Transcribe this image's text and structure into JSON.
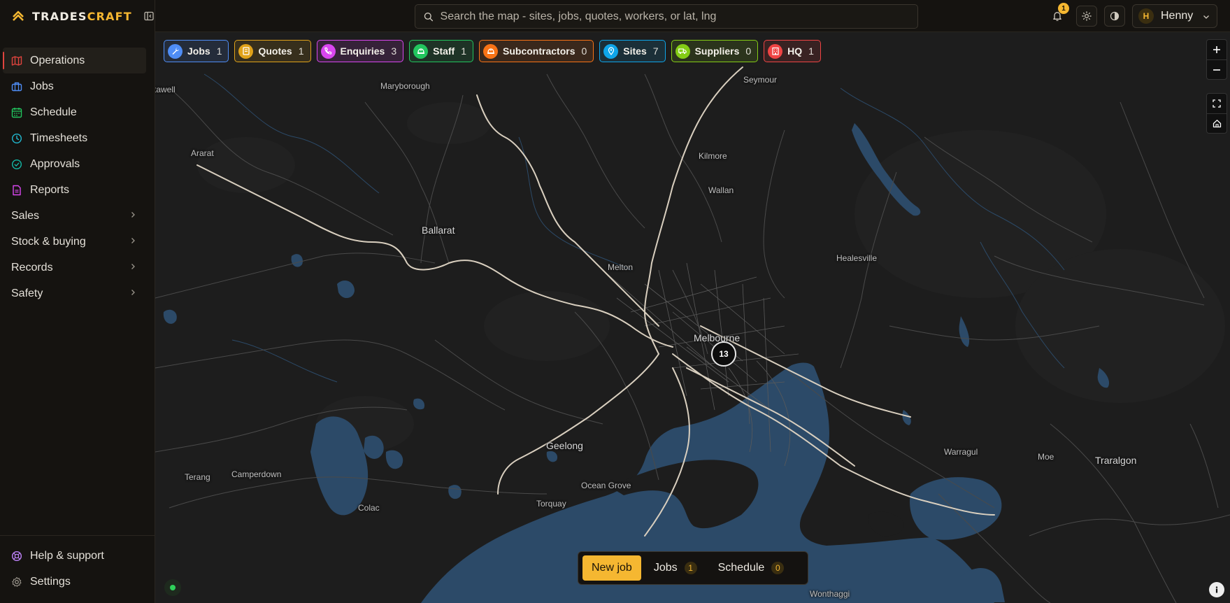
{
  "brand": {
    "name_part1": "TRADES",
    "name_part2": "CRAFT"
  },
  "sidebar": {
    "items": [
      {
        "label": "Operations",
        "icon": "map-icon",
        "color": "#e0443e"
      },
      {
        "label": "Jobs",
        "icon": "briefcase-icon",
        "color": "#4f8df5"
      },
      {
        "label": "Schedule",
        "icon": "calendar-icon",
        "color": "#22c55e"
      },
      {
        "label": "Timesheets",
        "icon": "clock-icon",
        "color": "#22b8cf"
      },
      {
        "label": "Approvals",
        "icon": "check-circle-icon",
        "color": "#14b8a6"
      },
      {
        "label": "Reports",
        "icon": "report-icon",
        "color": "#d946ef"
      }
    ],
    "groups": [
      {
        "label": "Sales"
      },
      {
        "label": "Stock & buying"
      },
      {
        "label": "Records"
      },
      {
        "label": "Safety"
      }
    ],
    "bottom": [
      {
        "label": "Help & support",
        "icon": "help-icon",
        "color": "#c084fc"
      },
      {
        "label": "Settings",
        "icon": "gear-icon",
        "color": "#9a958c"
      }
    ]
  },
  "topbar": {
    "search_placeholder": "Search the map - sites, jobs, quotes, workers, or lat, lng",
    "notification_count": "1",
    "user_initial": "H",
    "user_name": "Henny"
  },
  "map": {
    "layers": [
      {
        "label": "Jobs",
        "count": "1",
        "icon": "wrench-icon",
        "color": "#4f8df5"
      },
      {
        "label": "Quotes",
        "count": "1",
        "icon": "quote-icon",
        "color": "#e0a21a"
      },
      {
        "label": "Enquiries",
        "count": "3",
        "icon": "phone-icon",
        "color": "#d946ef"
      },
      {
        "label": "Staff",
        "count": "1",
        "icon": "hardhat-icon",
        "color": "#22c55e"
      },
      {
        "label": "Subcontractors",
        "count": "0",
        "icon": "hardhat-icon",
        "color": "#f97316"
      },
      {
        "label": "Sites",
        "count": "7",
        "icon": "pin-icon",
        "color": "#0ea5e9"
      },
      {
        "label": "Suppliers",
        "count": "0",
        "icon": "truck-icon",
        "color": "#84cc16"
      },
      {
        "label": "HQ",
        "count": "1",
        "icon": "building-icon",
        "color": "#ef4444"
      }
    ],
    "places": {
      "stawell": "tawell",
      "maryborough": "Maryborough",
      "seymour": "Seymour",
      "ararat": "Ararat",
      "kilmore": "Kilmore",
      "wallan": "Wallan",
      "ballarat": "Ballarat",
      "healesville": "Healesville",
      "melton": "Melton",
      "melbourne": "Melbourne",
      "geelong": "Geelong",
      "warragul": "Warragul",
      "moe": "Moe",
      "traralgon": "Traralgon",
      "terang": "Terang",
      "camperdown": "Camperdown",
      "ocean_grove": "Ocean Grove",
      "torquay": "Torquay",
      "colac": "Colac",
      "wonthaggi": "Wonthaggi"
    },
    "cluster_count": "13"
  },
  "action_bar": {
    "new_job": "New job",
    "jobs_label": "Jobs",
    "jobs_count": "1",
    "schedule_label": "Schedule",
    "schedule_count": "0"
  }
}
